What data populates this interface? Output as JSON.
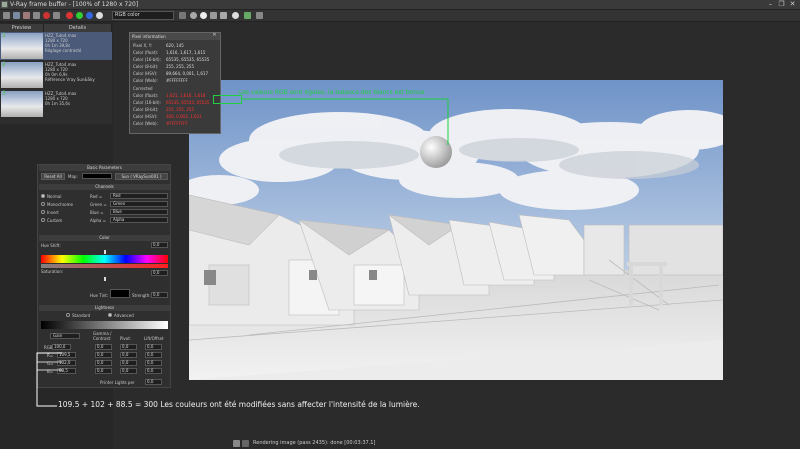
{
  "window": {
    "title": "V-Ray frame buffer - [100% of 1280 x 720]",
    "minimize": "–",
    "restore": "❐",
    "close": "✕"
  },
  "toolbar": {
    "channel": "RGB color",
    "icons": [
      "save-icon",
      "save-all-icon",
      "clear-icon",
      "copy-icon",
      "stop-icon",
      "region-icon",
      "red-channel-icon",
      "green-channel-icon",
      "blue-channel-icon",
      "alpha-channel-icon",
      "mono-icon",
      "track-mouse-icon",
      "lens-effects-icon",
      "lut-icon",
      "history-icon",
      "compare-icon",
      "display-correction-icon",
      "settings-icon"
    ]
  },
  "history": {
    "tab_preview": "Preview",
    "tab_details": "Details",
    "items": [
      {
        "num": "1",
        "file": "HZZ_Tuto4.max",
        "res": "1280 x 720",
        "time": "0h 1m 39,8s",
        "note": "Réglage contrasté"
      },
      {
        "num": "2",
        "file": "HZZ_Tuto4.max",
        "res": "1280 x 720",
        "time": "0h 0m 6,9s",
        "note": "Référence Vray Sun&Sky"
      },
      {
        "num": "3",
        "file": "HZZ_Tuto4.max",
        "res": "1280 x 720",
        "time": "0h 1m 35,6s",
        "note": ""
      }
    ]
  },
  "pixel_info": {
    "title": "Pixel information",
    "rows": [
      {
        "label": "Pixel X, Y:",
        "value": "620, 145"
      },
      {
        "label": "Color (float):",
        "value": "1,616, 1,617, 1,615"
      },
      {
        "label": "Color (16-bit):",
        "value": "65535, 65535, 65535"
      },
      {
        "label": "Color (8-bit):",
        "value": "255, 255, 255"
      },
      {
        "label": "Color (HSV):",
        "value": "89,664, 0,001, 1,617"
      },
      {
        "label": "Color (Web):",
        "value": "#FFFFFFFF"
      },
      {
        "label": "Corrected",
        "value": ""
      },
      {
        "label": "Color (float):",
        "value": "1,621, 1,616, 1,618"
      },
      {
        "label": "Color (16-bit):",
        "value": "65535, 65535, 65535"
      },
      {
        "label": "Color (8-bit):",
        "value": "255, 255, 255"
      },
      {
        "label": "Color (HSV):",
        "value": "300, 0,003, 1,621"
      },
      {
        "label": "Color (Web):",
        "value": "#FFFFFFFF"
      }
    ]
  },
  "annotation": {
    "text": "Les valeurs RGB sont égales, la balance des blancs est bonne",
    "color": "#20d040"
  },
  "bottom_note": "109.5 + 102 + 88.5 = 300  Les couleurs ont été modifiées sans affecter l'intensité de la lumière.",
  "params": {
    "basic_title": "Basic Parameters",
    "reset_all": "Reset All",
    "map_label": "Map:",
    "sun_label": "Sun  ( VRaySun001 )",
    "channels_title": "Channels",
    "channel_modes": [
      {
        "label": "Normal",
        "selected": true
      },
      {
        "label": "Monochrome",
        "selected": false
      },
      {
        "label": "Invert",
        "selected": false
      },
      {
        "label": "Custom",
        "selected": false
      }
    ],
    "channel_maps": [
      {
        "label": "Red =",
        "value": "Red"
      },
      {
        "label": "Green =",
        "value": "Green"
      },
      {
        "label": "Blue =",
        "value": "Blue"
      },
      {
        "label": "Alpha =",
        "value": "Alpha"
      }
    ],
    "color_title": "Color",
    "hue_shift_label": "Hue Shift:",
    "hue_shift_value": "0,0",
    "saturation_label": "Saturation:",
    "saturation_value": "0,0",
    "hue_tint_label": "Hue Tint:",
    "strength_label": "Strength:",
    "strength_value": "0,0",
    "lightness_title": "Lightness",
    "standard_label": "Standard",
    "advanced_label": "Advanced",
    "adv_mode": "Gain",
    "col_gamma": "Gamma / Contrast:",
    "col_pivot": "Pivot:",
    "col_lift": "Lift/Offset",
    "rgb_label": "RGB=",
    "rgb_values": [
      "100,0",
      "0,0",
      "0,0",
      "0,0"
    ],
    "rows": [
      {
        "label": "R=",
        "values": [
          "109,5",
          "0,0",
          "0,0",
          "0,0"
        ]
      },
      {
        "label": "G=",
        "values": [
          "102,0",
          "0,0",
          "0,0",
          "0,0"
        ]
      },
      {
        "label": "B=",
        "values": [
          "88,5",
          "0,0",
          "0,0",
          "0,0"
        ]
      }
    ],
    "printer_lights_label": "Printer Lights per",
    "printer_lights_value": "0,0"
  },
  "status": {
    "text": "Rendering image (pass 2435): done [00:03:37.1]"
  }
}
